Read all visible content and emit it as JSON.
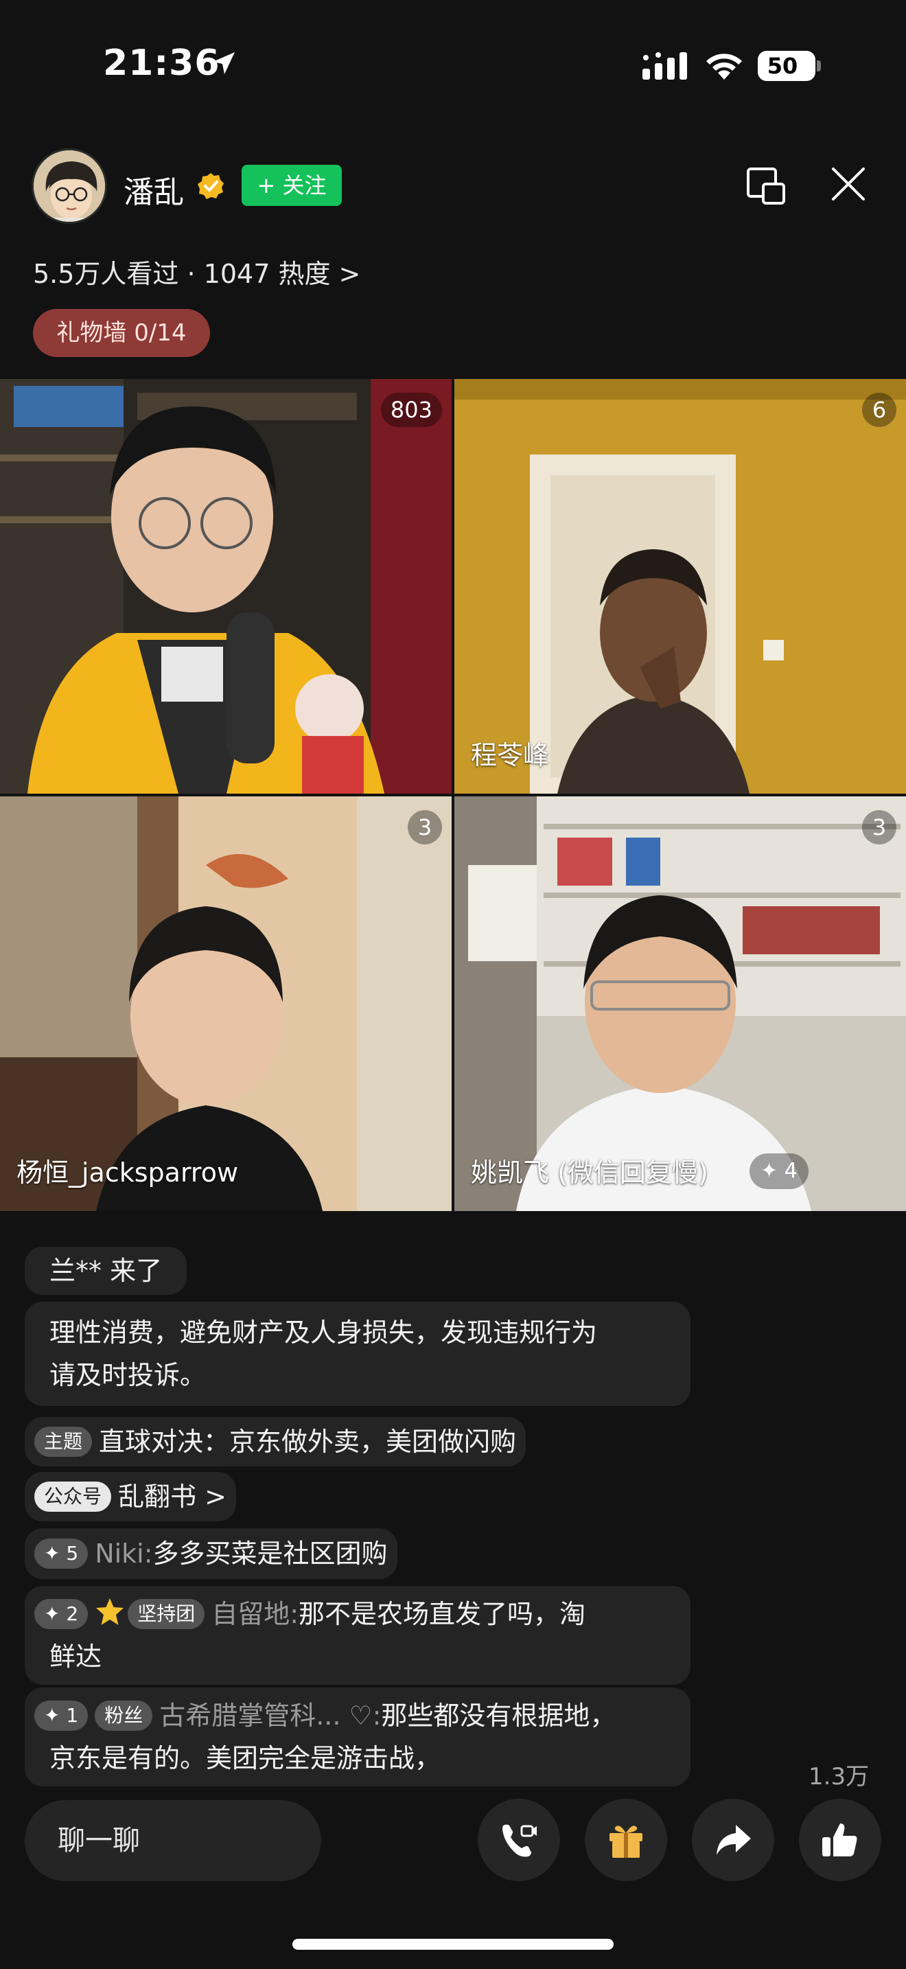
{
  "status_bar": {
    "time": "21:36",
    "battery": "50"
  },
  "header": {
    "host_name": "潘乱",
    "follow_label": "+ 关注",
    "stats": "5.5万人看过 · 1047 热度 >",
    "gift_wall": "礼物墙 0/14"
  },
  "tiles": [
    {
      "name": "",
      "count": "803"
    },
    {
      "name": "程苓峰",
      "count": "6"
    },
    {
      "name": "杨恒_jacksparrow",
      "count": "3"
    },
    {
      "name": "姚凯飞 (微信回复慢)",
      "count": "3",
      "badge": "✦ 4"
    }
  ],
  "chat": {
    "join_notice": "兰** 来了",
    "system_line1": "理性消费，避免财产及人身损失，发现违规行为",
    "system_line2": "请及时投诉。",
    "topic_chip": "主题",
    "topic_text": "直球对决：京东做外卖，美团做闪购",
    "official_chip": "公众号",
    "official_text": "乱翻书 >",
    "messages": [
      {
        "level": "✦ 5",
        "badge": "",
        "user": "Niki:",
        "text": "多多买菜是社区团购"
      },
      {
        "level": "✦ 2",
        "badge": "坚持团",
        "user": "自留地:",
        "text": "那不是农场直发了吗，淘",
        "text2": "鲜达"
      },
      {
        "level": "✦ 1",
        "badge": "粉丝",
        "user": "古希腊掌管科... ♡:",
        "text": "那些都没有根据地，",
        "text2": "京东是有的。美团完全是游击战，"
      }
    ]
  },
  "bottom": {
    "chat_placeholder": "聊一聊",
    "like_count": "1.3万"
  },
  "icons": [
    "location-arrow-icon",
    "signal-icon",
    "wifi-icon",
    "battery-icon",
    "verified-icon",
    "pip-icon",
    "close-icon",
    "video-call-icon",
    "gift-icon",
    "share-icon",
    "like-icon"
  ],
  "colors": {
    "follow": "#14c15a",
    "gift_wall": "#8e3a37",
    "background": "#121212"
  }
}
